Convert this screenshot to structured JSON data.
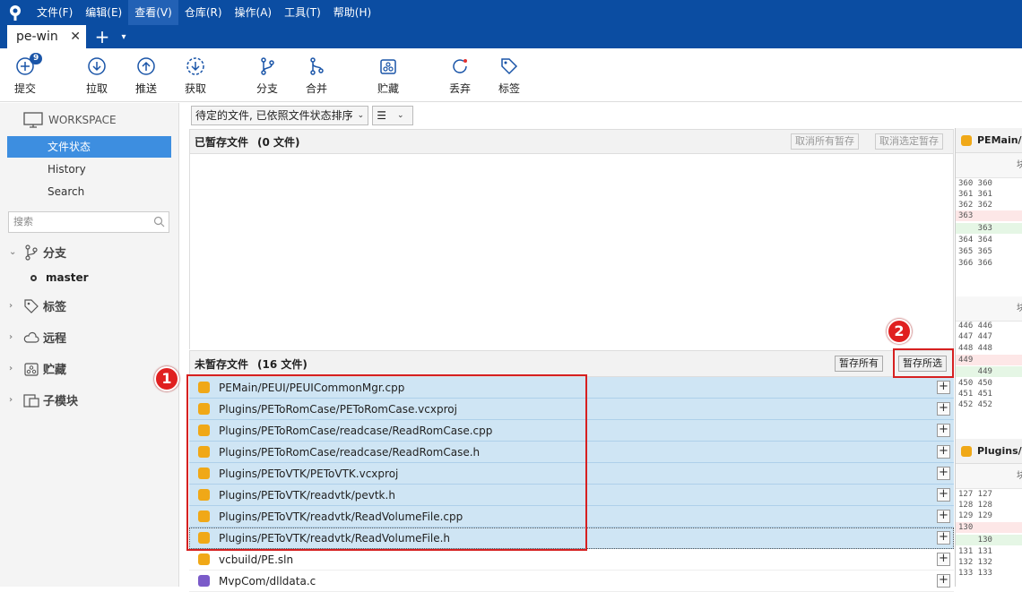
{
  "menu": [
    "文件(F)",
    "编辑(E)",
    "查看(V)",
    "仓库(R)",
    "操作(A)",
    "工具(T)",
    "帮助(H)"
  ],
  "tab": {
    "title": "pe-win",
    "close": "✕",
    "add": "+",
    "dropdown": "▾"
  },
  "toolbar": {
    "commit": "提交",
    "commit_badge": "9",
    "pull": "拉取",
    "push": "推送",
    "fetch": "获取",
    "branch": "分支",
    "merge": "合并",
    "stash": "贮藏",
    "discard": "丢弃",
    "tag": "标签"
  },
  "sidebar": {
    "workspace": "WORKSPACE",
    "nav": [
      "文件状态",
      "History",
      "Search"
    ],
    "search_placeholder": "搜索",
    "branches": "分支",
    "current_branch": "master",
    "tags": "标签",
    "remotes": "远程",
    "stashes": "贮藏",
    "submodules": "子模块"
  },
  "filter": {
    "sort": "待定的文件, 已依照文件状态排序",
    "view": "☰"
  },
  "staged": {
    "title": "已暂存文件",
    "count": "(0 文件)",
    "unstage_all": "取消所有暂存",
    "unstage_selected": "取消选定暂存"
  },
  "unstaged": {
    "title": "未暂存文件",
    "count": "(16 文件)",
    "stage_all": "暂存所有",
    "stage_selected": "暂存所选",
    "files": [
      "PEMain/PEUI/PEUICommonMgr.cpp",
      "Plugins/PEToRomCase/PEToRomCase.vcxproj",
      "Plugins/PEToRomCase/readcase/ReadRomCase.cpp",
      "Plugins/PEToRomCase/readcase/ReadRomCase.h",
      "Plugins/PEToVTK/PEToVTK.vcxproj",
      "Plugins/PEToVTK/readvtk/pevtk.h",
      "Plugins/PEToVTK/readvtk/ReadVolumeFile.cpp",
      "Plugins/PEToVTK/readvtk/ReadVolumeFile.h",
      "vcbuild/PE.sln",
      "MvpCom/dlldata.c"
    ]
  },
  "callouts": [
    "1",
    "2"
  ],
  "diff": {
    "file1": "PEMain/PEUI/PEUICommonMgr.cpp",
    "file2": "Plugins/PEToRomCase/PEToRomCase.vcxproj",
    "hunk_label": "块",
    "hunk1": [
      "360 360",
      "361 361",
      "362 362",
      "363    ",
      "    363",
      "364 364",
      "365 365",
      "366 366"
    ],
    "hunk2": [
      "446 446",
      "447 447",
      "448 448",
      "449    ",
      "    449",
      "450 450",
      "451 451",
      "452 452"
    ],
    "hunk3": [
      "127 127",
      "128 128",
      "129 129",
      "130    ",
      "    130",
      "131 131",
      "132 132",
      "133 133"
    ]
  }
}
